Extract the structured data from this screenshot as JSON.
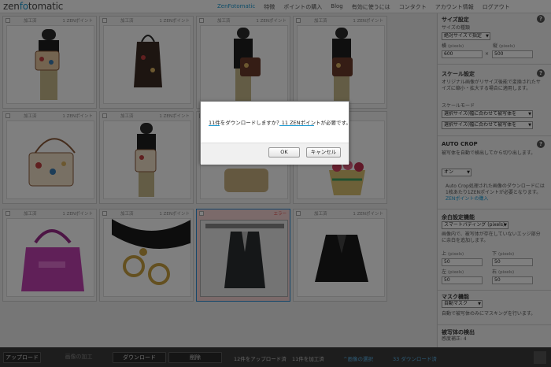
{
  "app": {
    "logo_main": "zen",
    "logo_accent": "fo",
    "logo_rest": "tomatic"
  },
  "nav": {
    "items": [
      "ZenFotomatic",
      "特徴",
      "ポイントの購入",
      "Blog",
      "有効に使うには",
      "コンタクト",
      "アカウント情報",
      "ログアウト"
    ]
  },
  "tiles": [
    {
      "status": "加工済",
      "points": "1 ZENポイント",
      "icon": "handbag-on-model-image"
    },
    {
      "status": "加工済",
      "points": "1 ZENポイント",
      "icon": "tote-bag-image"
    },
    {
      "status": "加工済",
      "points": "1 ZENポイント",
      "icon": "handbag-on-model-image"
    },
    {
      "status": "加工済",
      "points": "1 ZENポイント",
      "icon": "handbag-on-model-image"
    },
    {
      "status": "加工済",
      "points": "1 ZENポイント",
      "icon": "shoulder-bag-image"
    },
    {
      "status": "加工済",
      "points": "1 ZENポイント",
      "icon": "handbag-on-model-image"
    },
    {
      "status": "",
      "points": "",
      "icon": "bag-image"
    },
    {
      "status": "",
      "points": "",
      "icon": "straw-bag-image"
    },
    {
      "status": "加工済",
      "points": "1 ZENポイント",
      "icon": "purple-bag-image"
    },
    {
      "status": "加工済",
      "points": "1 ZENポイント",
      "icon": "jewelry-image"
    },
    {
      "status": "エラー",
      "points": "",
      "icon": "suit-jacket-image"
    },
    {
      "status": "加工済",
      "points": "1 ZENポイント",
      "icon": "black-jacket-image"
    }
  ],
  "sidebar": {
    "size_title": "サイズ設定",
    "size_type_label": "サイズの種類",
    "size_type_value": "絶対サイズで指定",
    "width_label": "横",
    "width_unit": "(pixels)",
    "width_value": "600",
    "height_label": "縦",
    "height_unit": "(pixels)",
    "height_value": "500",
    "times": "×",
    "scale_title": "スケール設定",
    "scale_desc": "オリジナル画像がリサイズ後能で変換されたサイズに縮小・拡大する場合に適用します。",
    "scale_mode_label": "スケールモード",
    "scale_mode_value_1": "選択サイズ(幅に合わせて被写体を",
    "scale_mode_value_2": "選択サイズ(幅に合わせて被写体を",
    "autocrop_title": "AUTO CROP",
    "autocrop_desc": "被写体を自動で検出してから切り出します。",
    "autocrop_value": "オン",
    "autocrop_note": "Auto Crop処理された画像のダウンロードには1枚あたり1ZENポイントが必要となります。",
    "autocrop_link": "ZENポイントの購入",
    "margin_title": "余白設定機能",
    "margin_mode_value": "スマートパディング (pixels)",
    "margin_desc": "画像内で、被写体が存在していないエッジ部分に余白を追加します。",
    "top_label": "上",
    "top_unit": "(pixels)",
    "top_value": "50",
    "bottom_label": "下",
    "bottom_unit": "(pixels)",
    "bottom_value": "50",
    "left_label": "左",
    "left_unit": "(pixels)",
    "left_value": "50",
    "right_label": "右",
    "right_unit": "(pixels)",
    "right_value": "50",
    "mask_title": "マスク機能",
    "mask_value": "自動マスク",
    "mask_desc": "自動で被写体のみにマスキングを行います。",
    "detect_title": "被写体の検出",
    "detect_value": "感度補正: 4",
    "help": "?"
  },
  "bottom": {
    "upload": "アップロード",
    "process": "画像の加工",
    "download": "ダウンロード",
    "delete": "削除",
    "uploaded": "12件をアップロード済",
    "processed": "11件を加工済",
    "select_images": "^画像の選択",
    "downloaded": "33 ダウンロード済"
  },
  "dialog": {
    "message": "11件をダウンロードしますか？11 ZENポイントが必要です。",
    "ok": "OK",
    "cancel": "キャンセル"
  }
}
